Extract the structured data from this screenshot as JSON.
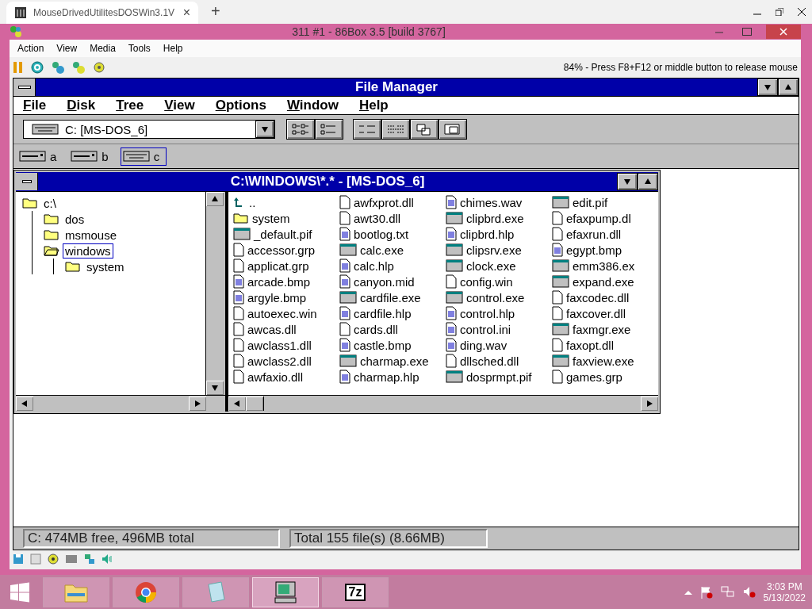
{
  "browser": {
    "tab": {
      "title": "MouseDrivedUtilitesDOSWin3.1V",
      "close": "×"
    },
    "new_tab": "+"
  },
  "window": {
    "title": "311 #1 - 86Box 3.5 [build 3767]",
    "menu": [
      "Action",
      "View",
      "Media",
      "Tools",
      "Help"
    ],
    "status_message": "84% - Press F8+F12 or middle button to release mouse"
  },
  "file_manager": {
    "title": "File Manager",
    "menu": [
      "File",
      "Disk",
      "Tree",
      "View",
      "Options",
      "Window",
      "Help"
    ],
    "drive_combo": "C: [MS-DOS_6]",
    "drives": [
      {
        "letter": "a",
        "kind": "floppy",
        "selected": false
      },
      {
        "letter": "b",
        "kind": "floppy",
        "selected": false
      },
      {
        "letter": "c",
        "kind": "hard",
        "selected": true
      }
    ],
    "child": {
      "title": "C:\\WINDOWS\\*.* - [MS-DOS_6]",
      "tree": [
        {
          "label": "c:\\",
          "selected": false,
          "children": [
            {
              "label": "dos",
              "selected": false
            },
            {
              "label": "msmouse",
              "selected": false
            },
            {
              "label": "windows",
              "selected": true,
              "children": [
                {
                  "label": "system",
                  "selected": false
                }
              ]
            }
          ]
        }
      ],
      "files": [
        {
          "name": "..",
          "kind": "up"
        },
        {
          "name": "system",
          "kind": "folder"
        },
        {
          "name": "_default.pif",
          "kind": "program"
        },
        {
          "name": "accessor.grp",
          "kind": "file"
        },
        {
          "name": "applicat.grp",
          "kind": "file"
        },
        {
          "name": "arcade.bmp",
          "kind": "document"
        },
        {
          "name": "argyle.bmp",
          "kind": "document"
        },
        {
          "name": "autoexec.win",
          "kind": "file"
        },
        {
          "name": "awcas.dll",
          "kind": "file"
        },
        {
          "name": "awclass1.dll",
          "kind": "file"
        },
        {
          "name": "awclass2.dll",
          "kind": "file"
        },
        {
          "name": "awfaxio.dll",
          "kind": "file"
        },
        {
          "name": "awfxprot.dll",
          "kind": "file"
        },
        {
          "name": "awt30.dll",
          "kind": "file"
        },
        {
          "name": "bootlog.txt",
          "kind": "document"
        },
        {
          "name": "calc.exe",
          "kind": "program"
        },
        {
          "name": "calc.hlp",
          "kind": "document"
        },
        {
          "name": "canyon.mid",
          "kind": "document"
        },
        {
          "name": "cardfile.exe",
          "kind": "program"
        },
        {
          "name": "cardfile.hlp",
          "kind": "document"
        },
        {
          "name": "cards.dll",
          "kind": "file"
        },
        {
          "name": "castle.bmp",
          "kind": "document"
        },
        {
          "name": "charmap.exe",
          "kind": "program"
        },
        {
          "name": "charmap.hlp",
          "kind": "document"
        },
        {
          "name": "chimes.wav",
          "kind": "document"
        },
        {
          "name": "clipbrd.exe",
          "kind": "program"
        },
        {
          "name": "clipbrd.hlp",
          "kind": "document"
        },
        {
          "name": "clipsrv.exe",
          "kind": "program"
        },
        {
          "name": "clock.exe",
          "kind": "program"
        },
        {
          "name": "config.win",
          "kind": "file"
        },
        {
          "name": "control.exe",
          "kind": "program"
        },
        {
          "name": "control.hlp",
          "kind": "document"
        },
        {
          "name": "control.ini",
          "kind": "document"
        },
        {
          "name": "ding.wav",
          "kind": "document"
        },
        {
          "name": "dllsched.dll",
          "kind": "file"
        },
        {
          "name": "dosprmpt.pif",
          "kind": "program"
        },
        {
          "name": "edit.pif",
          "kind": "program"
        },
        {
          "name": "efaxpump.dl",
          "kind": "file"
        },
        {
          "name": "efaxrun.dll",
          "kind": "file"
        },
        {
          "name": "egypt.bmp",
          "kind": "document"
        },
        {
          "name": "emm386.ex",
          "kind": "program"
        },
        {
          "name": "expand.exe",
          "kind": "program"
        },
        {
          "name": "faxcodec.dll",
          "kind": "file"
        },
        {
          "name": "faxcover.dll",
          "kind": "file"
        },
        {
          "name": "faxmgr.exe",
          "kind": "program"
        },
        {
          "name": "faxopt.dll",
          "kind": "file"
        },
        {
          "name": "faxview.exe",
          "kind": "program"
        },
        {
          "name": "games.grp",
          "kind": "file"
        }
      ]
    },
    "status": [
      "C: 474MB free,  496MB total",
      "Total 155 file(s) (8.66MB)"
    ]
  },
  "taskbar": {
    "apps": [
      {
        "kind": "explorer",
        "selected": false
      },
      {
        "kind": "chrome",
        "selected": false
      },
      {
        "kind": "notepad",
        "selected": false
      },
      {
        "kind": "emulator",
        "selected": true
      },
      {
        "kind": "archiver",
        "label": "7z",
        "selected": false
      }
    ],
    "time": "3:03 PM",
    "date": "5/13/2022"
  }
}
